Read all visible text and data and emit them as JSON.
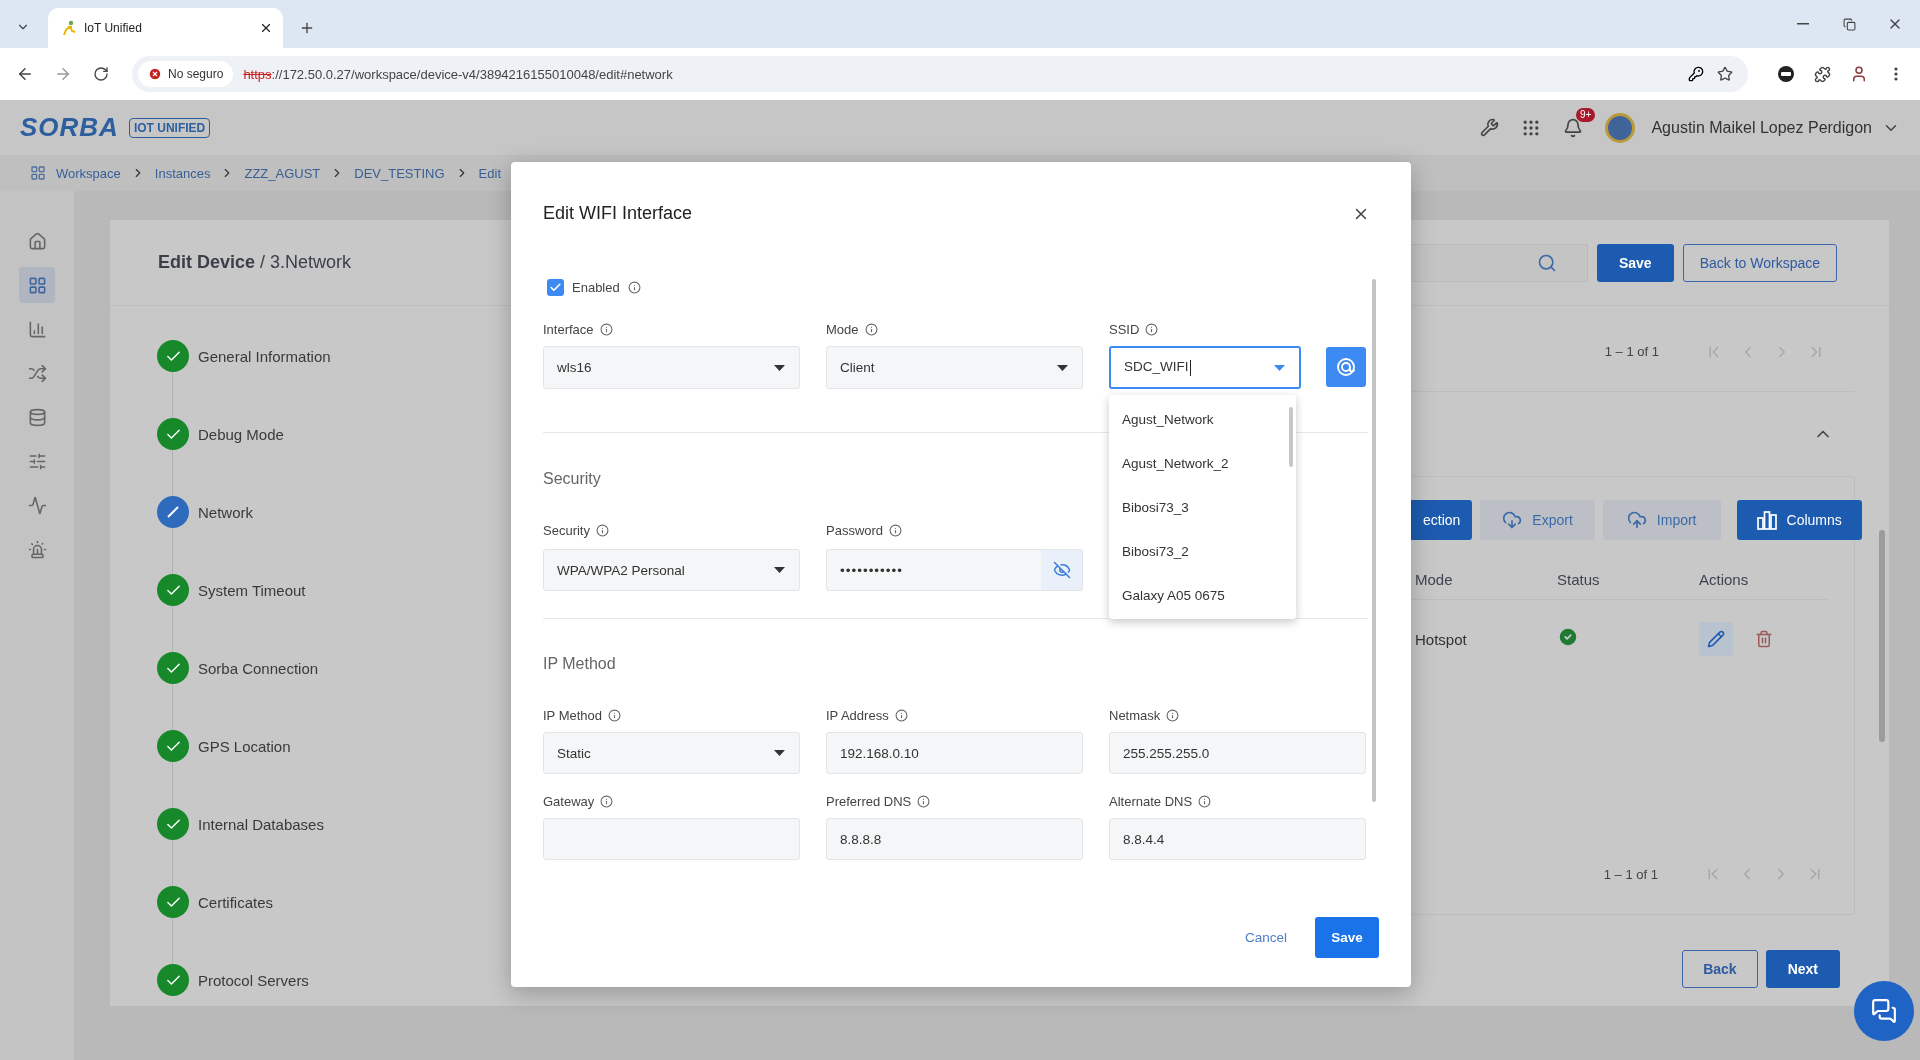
{
  "browser": {
    "tab_title": "IoT Unified",
    "security_label": "No seguro",
    "url_scheme": "https",
    "url_path": "://172.50.0.27/workspace/device-v4/3894216155010048/edit#network"
  },
  "app_header": {
    "logo": "SORBA",
    "product_badge": "IOT UNIFIED",
    "notification_count": "9+",
    "user_name": "Agustin Maikel Lopez Perdigon"
  },
  "sidebar": {
    "items": [
      {
        "selected": false
      },
      {
        "selected": true
      },
      {
        "selected": false
      },
      {
        "selected": false
      },
      {
        "selected": false
      },
      {
        "selected": false
      },
      {
        "selected": false
      },
      {
        "selected": false
      }
    ]
  },
  "breadcrumb": [
    "Workspace",
    "Instances",
    "ZZZ_AGUST",
    "DEV_TESTING",
    "Edit"
  ],
  "page": {
    "heading": "**Edit Device** / 3.Network",
    "actions": [
      {
        "label": "Save",
        "kind": "primary"
      },
      {
        "label": "Back to Workspace",
        "kind": "outline"
      }
    ]
  },
  "steps": [
    {
      "label": "General Information",
      "completed": true,
      "selected": false
    },
    {
      "label": "Debug Mode",
      "completed": true,
      "selected": false
    },
    {
      "label": "Network",
      "completed": false,
      "selected": true
    },
    {
      "label": "System Timeout",
      "completed": true,
      "selected": false
    },
    {
      "label": "Sorba Connection",
      "completed": true,
      "selected": false
    },
    {
      "label": "GPS Location",
      "completed": true,
      "selected": false
    },
    {
      "label": "Internal Databases",
      "completed": true,
      "selected": false
    },
    {
      "label": "Certificates",
      "completed": true,
      "selected": false
    },
    {
      "label": "Protocol Servers",
      "completed": true,
      "selected": false
    }
  ],
  "interfaces_panel": {
    "pagination": "1 – 1 of 1"
  },
  "connections_panel": {
    "expanded": true,
    "toolbar": [
      {
        "label": "ection",
        "kind": "primary"
      },
      {
        "label": "Export",
        "kind": "export"
      },
      {
        "label": "Import",
        "kind": "import"
      },
      {
        "label": "Columns",
        "kind": "columns"
      }
    ],
    "columns": [
      "Mode",
      "Status",
      "Actions"
    ],
    "rows": [
      {
        "mode": "Hotspot",
        "active": true
      }
    ],
    "pagination": "1 – 1 of 1"
  },
  "wizard_buttons": [
    {
      "label": "Back",
      "kind": "outline"
    },
    {
      "label": "Next",
      "kind": "primary"
    }
  ],
  "modal": {
    "title": "Edit WIFI Interface",
    "enabled": {
      "label": "Enabled",
      "checked": true
    },
    "fields": [
      {
        "label": "Interface",
        "kind": "select",
        "value": "wls16",
        "focused": false
      },
      {
        "label": "Mode",
        "kind": "select",
        "value": "Client",
        "focused": false
      },
      {
        "label": "SSID",
        "kind": "combo",
        "value": "SDC_WIFI",
        "focused": true,
        "expanded": true
      }
    ],
    "ssid_options": [
      "Agust_Network",
      "Agust_Network_2",
      "Bibosi73_3",
      "Bibosi73_2",
      "Galaxy A05 0675"
    ],
    "sections": [
      {
        "title": "Security",
        "fields": [
          {
            "label": "Security",
            "kind": "select",
            "value": "WPA/WPA2 Personal"
          },
          {
            "label": "Password",
            "kind": "password",
            "value": "•••••••••••",
            "revealed": false
          }
        ]
      },
      {
        "title": "IP Method",
        "fields": [
          {
            "label": "IP Method",
            "kind": "select",
            "value": "Static"
          },
          {
            "label": "IP Address",
            "kind": "text",
            "value": "192.168.0.10"
          },
          {
            "label": "Netmask",
            "kind": "text",
            "value": "255.255.255.0"
          },
          {
            "label": "Gateway",
            "kind": "text"
          },
          {
            "label": "Preferred DNS",
            "kind": "text",
            "value": "8.8.8.8"
          },
          {
            "label": "Alternate DNS",
            "kind": "text",
            "value": "8.8.4.4"
          }
        ]
      }
    ],
    "cancel": "Cancel",
    "save": "Save"
  }
}
